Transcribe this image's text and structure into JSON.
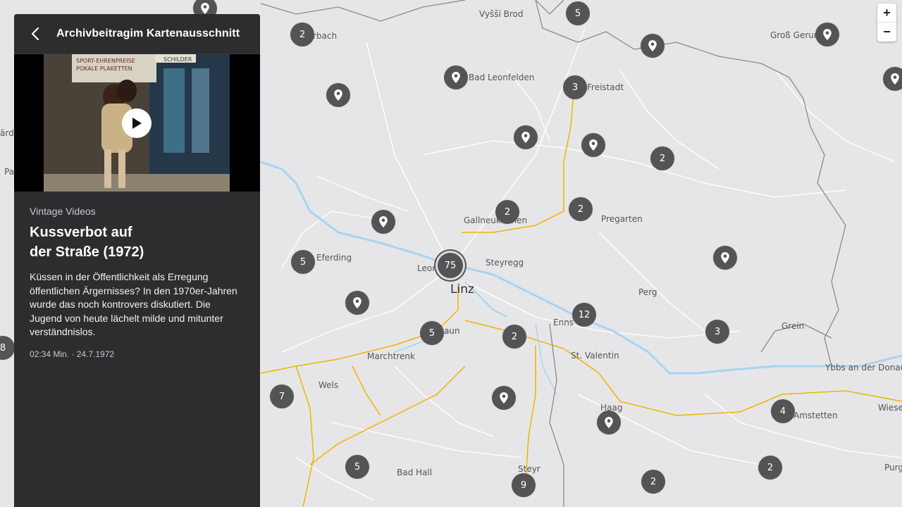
{
  "panel": {
    "title": "Archivbeitragim Kartenausschnitt",
    "category": "Vintage Videos",
    "headline": "Kussverbot auf\nder Straße (1972)",
    "description": "Küssen in der Öffentlichkeit als Erregung öffentlichen Ärgernisses? In den 1970er-Jahren wurde das noch kontrovers diskutiert. Die Jugend von heute lächelt milde und mitunter verständnislos.",
    "meta": "02:34 Min. · 24.7.1972",
    "thumbnail_signs": [
      "SPORT-EHRENPREISE",
      "POKALE PLAKETTEN",
      "SCHILDER"
    ]
  },
  "zoom": {
    "in_label": "+",
    "out_label": "−"
  },
  "places": [
    {
      "id": "vyssi-brod",
      "label": "Vyšší Brod"
    },
    {
      "id": "rbach",
      "label": "rbach"
    },
    {
      "id": "gross-gerungs",
      "label": "Groß Gerungs"
    },
    {
      "id": "bad-leonfelden",
      "label": "Bad Leonfelden"
    },
    {
      "id": "freistadt",
      "label": "Freistadt"
    },
    {
      "id": "gallneukirchen",
      "label": "Gallneukirchen"
    },
    {
      "id": "pregarten",
      "label": "Pregarten"
    },
    {
      "id": "eferding",
      "label": "Eferding"
    },
    {
      "id": "leonding",
      "label": "Leond"
    },
    {
      "id": "steyregg",
      "label": "Steyregg"
    },
    {
      "id": "linz",
      "label": "Linz"
    },
    {
      "id": "perg",
      "label": "Perg"
    },
    {
      "id": "enns",
      "label": "Enns"
    },
    {
      "id": "traun",
      "label": "aun"
    },
    {
      "id": "grein",
      "label": "Grein"
    },
    {
      "id": "marchtrenk",
      "label": "Marchtrenk"
    },
    {
      "id": "st-valentin",
      "label": "St. Valentin"
    },
    {
      "id": "ybbs",
      "label": "Ybbs an der Donau"
    },
    {
      "id": "wels",
      "label": "Wels"
    },
    {
      "id": "haag",
      "label": "Haag"
    },
    {
      "id": "amstetten",
      "label": "Amstetten"
    },
    {
      "id": "wiesel",
      "label": "Wiesel"
    },
    {
      "id": "steyr",
      "label": "Steyr"
    },
    {
      "id": "bad-hall",
      "label": "Bad Hall"
    },
    {
      "id": "purgs",
      "label": "Purgs"
    },
    {
      "id": "pas",
      "label": "Pas"
    },
    {
      "id": "ardin",
      "label": "ärdin"
    }
  ],
  "clusters": [
    {
      "id": "c1",
      "count": "2"
    },
    {
      "id": "c2",
      "count": "5"
    },
    {
      "id": "c3",
      "count": "3"
    },
    {
      "id": "c4",
      "count": "2"
    },
    {
      "id": "c5",
      "count": "2"
    },
    {
      "id": "c6",
      "count": "2"
    },
    {
      "id": "c7",
      "count": "5"
    },
    {
      "id": "c8",
      "count": "75"
    },
    {
      "id": "c9",
      "count": "12"
    },
    {
      "id": "c10",
      "count": "5"
    },
    {
      "id": "c11",
      "count": "2"
    },
    {
      "id": "c12",
      "count": "3"
    },
    {
      "id": "c13",
      "count": "8"
    },
    {
      "id": "c14",
      "count": "7"
    },
    {
      "id": "c15",
      "count": "4"
    },
    {
      "id": "c16",
      "count": "5"
    },
    {
      "id": "c17",
      "count": "9"
    },
    {
      "id": "c18",
      "count": "2"
    },
    {
      "id": "c19",
      "count": "2"
    }
  ],
  "pin_icon": "location-pin-icon",
  "colors": {
    "map_bg": "#e6e6e8",
    "road": "#f0b400",
    "river": "#a9d4ef",
    "border": "#8a8a8a",
    "marker": "#545457",
    "panel": "#2d2d30"
  }
}
